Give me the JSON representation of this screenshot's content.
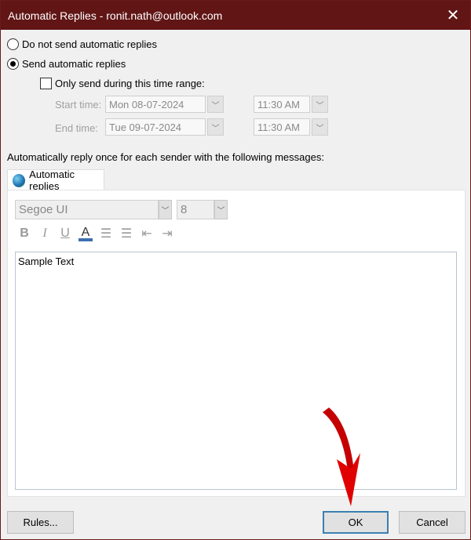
{
  "window": {
    "title": "Automatic Replies - ronit.nath@outlook.com",
    "close_icon": "close-icon"
  },
  "options": {
    "do_not_send": {
      "label": "Do not send automatic replies",
      "selected": false
    },
    "send": {
      "label": "Send automatic replies",
      "selected": true
    },
    "time_range": {
      "label": "Only send during this time range:",
      "checked": false
    },
    "start_time": {
      "label": "Start time:",
      "date": "Mon 08-07-2024",
      "time": "11:30 AM"
    },
    "end_time": {
      "label": "End time:",
      "date": "Tue 09-07-2024",
      "time": "11:30 AM"
    }
  },
  "instruction": "Automatically reply once for each sender with the following messages:",
  "tab": {
    "label": "Automatic replies",
    "icon": "globe-icon"
  },
  "formatting": {
    "font": "Segoe UI",
    "size": "8",
    "buttons": [
      "B",
      "I",
      "U",
      "A"
    ],
    "underline_color": "#3d6fb0"
  },
  "editor": {
    "text": "Sample Text"
  },
  "buttons": {
    "rules": "Rules...",
    "ok": "OK",
    "cancel": "Cancel"
  },
  "annotation": {
    "arrow_color": "#cc0000",
    "target": "OK"
  }
}
